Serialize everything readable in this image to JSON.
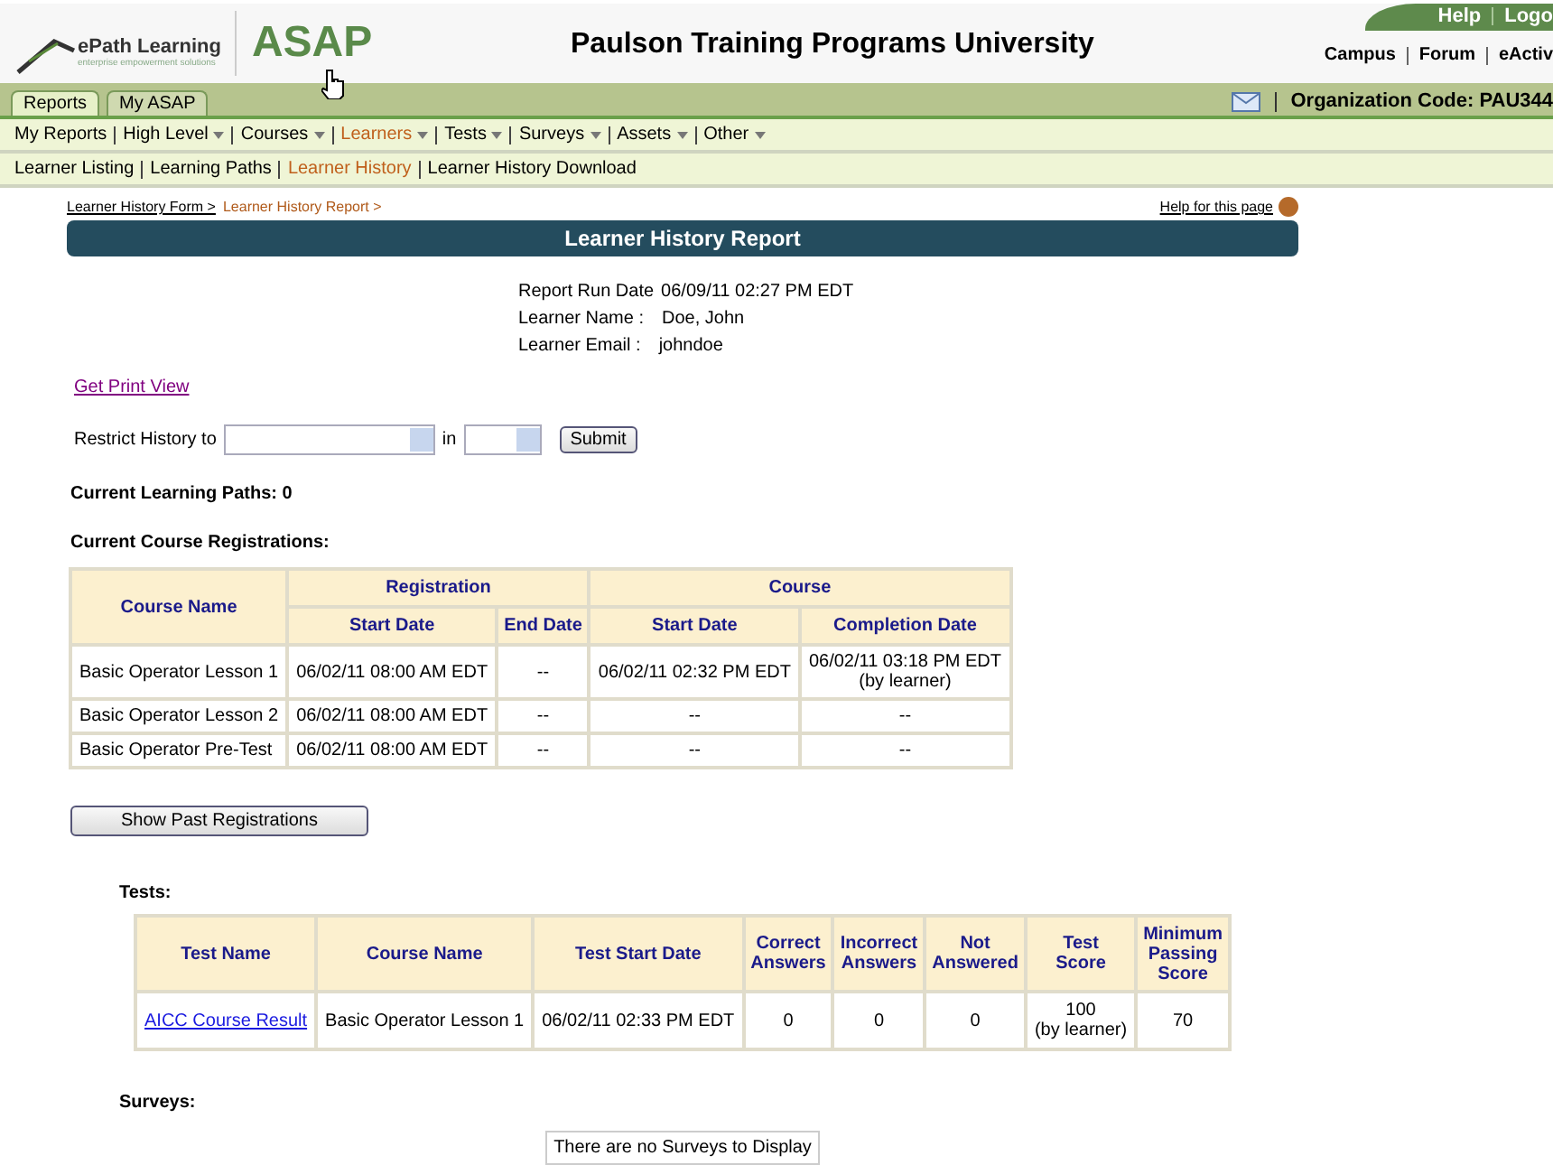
{
  "header": {
    "logo_text": "ePath Learning",
    "logo_tagline": "enterprise empowerment solutions",
    "product": "ASAP",
    "title": "Paulson Training Programs University",
    "top_links": [
      "Help",
      "Logo"
    ],
    "links": [
      "Campus",
      "Forum",
      "eActiv"
    ],
    "org_code": "Organization Code: PAU344"
  },
  "tabs": [
    {
      "label": "Reports",
      "selected": true
    },
    {
      "label": "My ASAP",
      "selected": false
    }
  ],
  "menu": [
    {
      "label": "My Reports",
      "has_menu": false,
      "selected": false
    },
    {
      "label": "High Level",
      "has_menu": true,
      "selected": false
    },
    {
      "label": "Courses",
      "has_menu": true,
      "selected": false
    },
    {
      "label": "Learners",
      "has_menu": true,
      "selected": true
    },
    {
      "label": "Tests",
      "has_menu": true,
      "selected": false
    },
    {
      "label": "Surveys",
      "has_menu": true,
      "selected": false
    },
    {
      "label": "Assets",
      "has_menu": true,
      "selected": false
    },
    {
      "label": "Other",
      "has_menu": true,
      "selected": false
    }
  ],
  "submenu": [
    {
      "label": "Learner Listing",
      "selected": false
    },
    {
      "label": "Learning Paths",
      "selected": false
    },
    {
      "label": "Learner History",
      "selected": true
    },
    {
      "label": "Learner History Download",
      "selected": false
    }
  ],
  "breadcrumb": [
    {
      "label": "Learner History Form >",
      "link": true
    },
    {
      "label": "Learner History Report >",
      "link": false
    }
  ],
  "help_link": "Help for this page",
  "report_title": "Learner History Report",
  "info": [
    {
      "label": "Report Run Date",
      "value": "06/09/11 02:27 PM EDT"
    },
    {
      "label": "Learner Name :",
      "value": "Doe, John"
    },
    {
      "label": "Learner Email :",
      "value": "johndoe"
    }
  ],
  "print_link": "Get Print View",
  "restrict": {
    "label": "Restrict History to",
    "in_label": "in",
    "button": "Submit"
  },
  "learning_paths": "Current Learning Paths: 0",
  "registrations": {
    "heading": "Current Course Registrations:",
    "group_headers": [
      "Registration",
      "Course"
    ],
    "columns": [
      "Course Name",
      "Start Date",
      "End Date",
      "Start Date",
      "Completion Date"
    ],
    "rows": [
      [
        "Basic Operator Lesson 1",
        "06/02/11 08:00 AM EDT",
        "--",
        "06/02/11 02:32 PM EDT",
        "06/02/11 03:18 PM EDT\n(by learner)"
      ],
      [
        "Basic Operator Lesson 2",
        "06/02/11 08:00 AM EDT",
        "--",
        "--",
        "--"
      ],
      [
        "Basic Operator Pre-Test",
        "06/02/11 08:00 AM EDT",
        "--",
        "--",
        "--"
      ]
    ],
    "button": "Show Past Registrations"
  },
  "tests": {
    "heading": "Tests:",
    "columns": [
      "Test Name",
      "Course Name",
      "Test Start Date",
      "Correct\nAnswers",
      "Incorrect\nAnswers",
      "Not\nAnswered",
      "Test\nScore",
      "Minimum\nPassing\nScore"
    ],
    "rows": [
      [
        "AICC Course Result",
        "Basic Operator Lesson 1",
        "06/02/11 02:33 PM EDT",
        "0",
        "0",
        "0",
        "100\n(by learner)",
        "70"
      ]
    ]
  },
  "surveys": {
    "heading": "Surveys:",
    "empty": "There are no Surveys to Display"
  }
}
